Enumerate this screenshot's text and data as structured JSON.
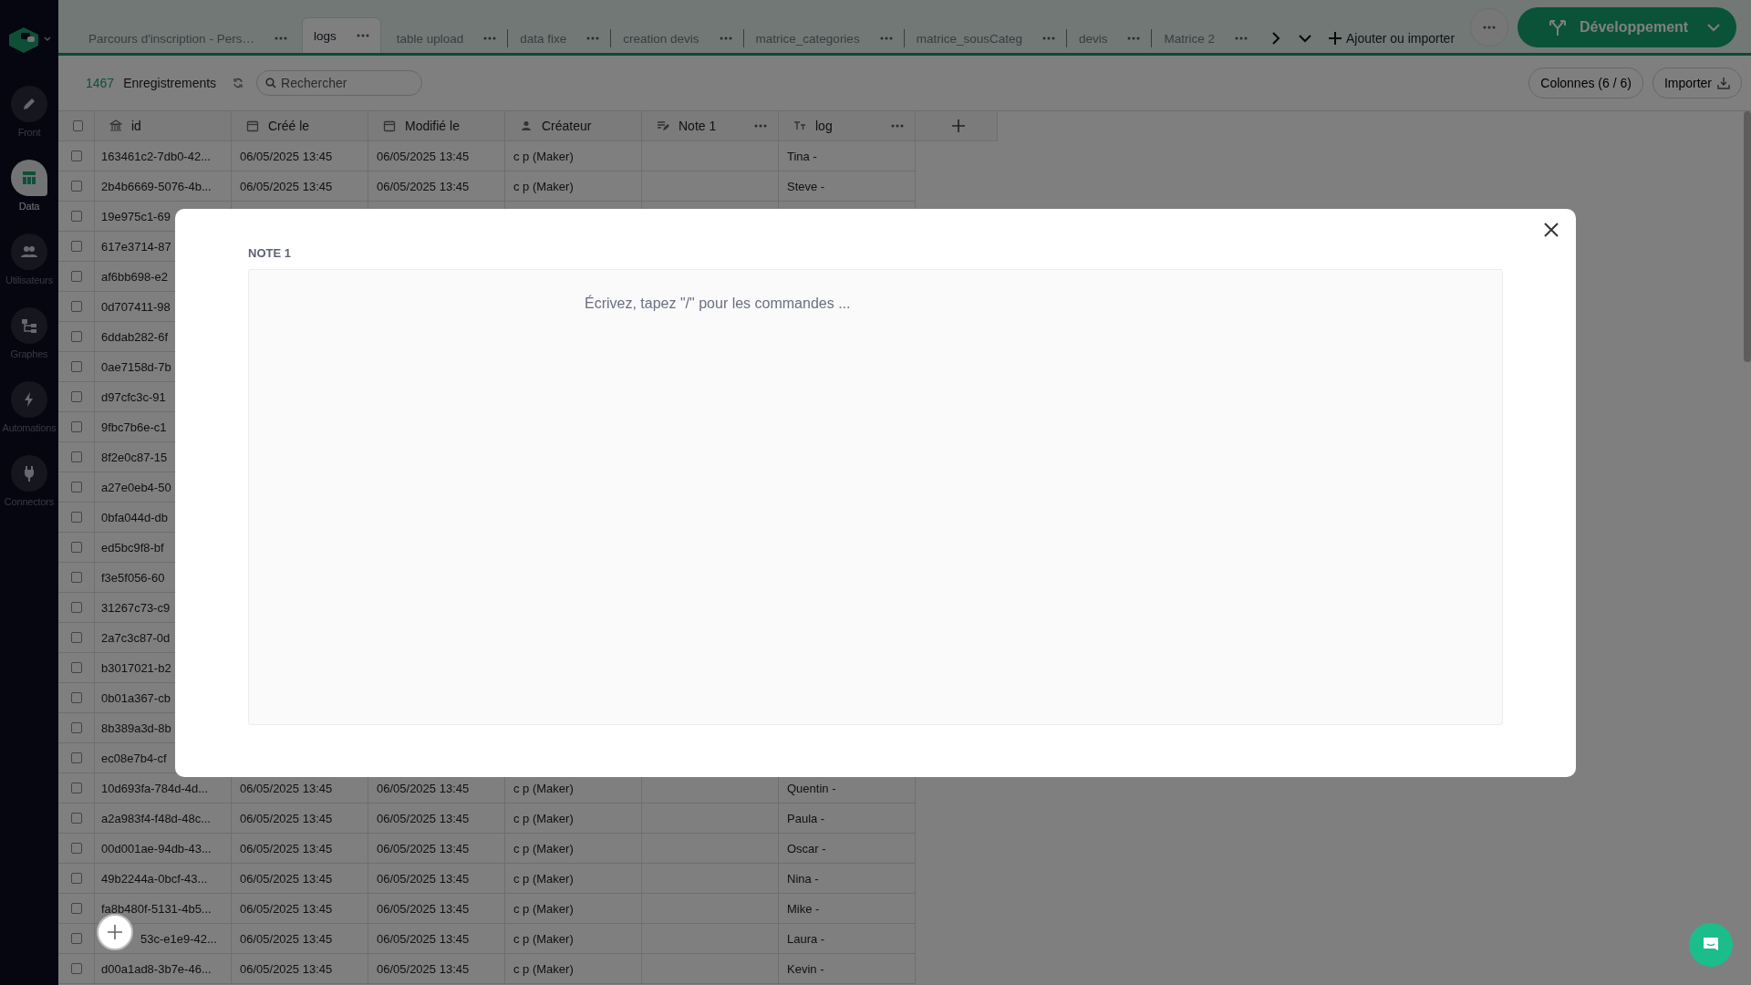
{
  "sidebar": {
    "items": [
      {
        "label": "Front",
        "kind": "pencil",
        "selected": false
      },
      {
        "label": "Data",
        "kind": "table",
        "selected": true
      },
      {
        "label": "Utilisateurs",
        "kind": "users",
        "selected": false
      },
      {
        "label": "Graphes",
        "kind": "graph",
        "selected": false
      },
      {
        "label": "Automations",
        "kind": "bolt",
        "selected": false
      },
      {
        "label": "Connectors",
        "kind": "plug",
        "selected": false
      }
    ]
  },
  "tabs": [
    {
      "label": "Parcours d'inscription - Pers…",
      "selected": false
    },
    {
      "label": "logs",
      "selected": true
    },
    {
      "label": "table upload",
      "selected": false
    },
    {
      "label": "data fixe",
      "selected": false
    },
    {
      "label": "creation devis",
      "selected": false
    },
    {
      "label": "matrice_categories",
      "selected": false
    },
    {
      "label": "matrice_sousCateg",
      "selected": false
    },
    {
      "label": "devis",
      "selected": false
    },
    {
      "label": "Matrice 2",
      "selected": false
    }
  ],
  "add_tab": {
    "label": "Ajouter ou importer"
  },
  "environment_button": {
    "label": "Développement"
  },
  "toolbar": {
    "count": "1467",
    "count_label": "Enregistrements",
    "search": {
      "placeholder": "Rechercher"
    },
    "columns_button": "Colonnes (6 / 6)",
    "import_button": "Importer"
  },
  "table": {
    "all_selected": false,
    "columns": [
      {
        "label": "id",
        "kind": "id",
        "menu": false
      },
      {
        "label": "Créé le",
        "kind": "date",
        "menu": false
      },
      {
        "label": "Modifié le",
        "kind": "date",
        "menu": false
      },
      {
        "label": "Créateur",
        "kind": "user",
        "menu": false
      },
      {
        "label": "Note 1",
        "kind": "richtext",
        "menu": true
      },
      {
        "label": "log",
        "kind": "text",
        "menu": true
      }
    ],
    "rows": [
      {
        "selected": false,
        "id": "163461c2-7db0-42...",
        "created": "06/05/2025 13:45",
        "modified": "06/05/2025 13:45",
        "creator": "c p (Maker)",
        "log": "Tina -"
      },
      {
        "selected": false,
        "id": "2b4b6669-5076-4b...",
        "created": "06/05/2025 13:45",
        "modified": "06/05/2025 13:45",
        "creator": "c p (Maker)",
        "log": "Steve -"
      },
      {
        "selected": false,
        "id": "19e975c1-69"
      },
      {
        "selected": false,
        "id": "617e3714-87"
      },
      {
        "selected": false,
        "id": "af6bb698-e2"
      },
      {
        "selected": false,
        "id": "0d707411-98"
      },
      {
        "selected": false,
        "id": "6ddab282-6f"
      },
      {
        "selected": false,
        "id": "0ae7158d-7b"
      },
      {
        "selected": false,
        "id": "d97cfc3c-91"
      },
      {
        "selected": false,
        "id": "9fbc7b6e-c1"
      },
      {
        "selected": false,
        "id": "8f2e0c87-15"
      },
      {
        "selected": false,
        "id": "a27e0eb4-50"
      },
      {
        "selected": false,
        "id": "0bfa044d-db"
      },
      {
        "selected": false,
        "id": "ed5bc9f8-bf"
      },
      {
        "selected": false,
        "id": "f3e5f056-60"
      },
      {
        "selected": false,
        "id": "31267c73-c9"
      },
      {
        "selected": false,
        "id": "2a7c3c87-0d"
      },
      {
        "selected": false,
        "id": "b3017021-b2"
      },
      {
        "selected": false,
        "id": "0b01a367-cb"
      },
      {
        "selected": false,
        "id": "8b389a3d-8b"
      },
      {
        "selected": false,
        "id": "ec08e7b4-cf"
      },
      {
        "selected": false,
        "id": "10d693fa-784d-4d...",
        "created": "06/05/2025 13:45",
        "modified": "06/05/2025 13:45",
        "creator": "c p (Maker)",
        "log": "Quentin -"
      },
      {
        "selected": false,
        "id": "a2a983f4-f48d-48c...",
        "created": "06/05/2025 13:45",
        "modified": "06/05/2025 13:45",
        "creator": "c p (Maker)",
        "log": "Paula -"
      },
      {
        "selected": false,
        "id": "00d001ae-94db-43...",
        "created": "06/05/2025 13:45",
        "modified": "06/05/2025 13:45",
        "creator": "c p (Maker)",
        "log": "Oscar -"
      },
      {
        "selected": false,
        "id": "49b2244a-0bcf-43...",
        "created": "06/05/2025 13:45",
        "modified": "06/05/2025 13:45",
        "creator": "c p (Maker)",
        "log": "Nina -"
      },
      {
        "selected": false,
        "id": "fa8b480f-5131-4b5...",
        "created": "06/05/2025 13:45",
        "modified": "06/05/2025 13:45",
        "creator": "c p (Maker)",
        "log": "Mike -"
      },
      {
        "selected": false,
        "id": "53c-e1e9-42...",
        "created": "06/05/2025 13:45",
        "modified": "06/05/2025 13:45",
        "creator": "c p (Maker)",
        "log": "Laura -"
      },
      {
        "selected": false,
        "id": "d00a1ad8-3b7e-46...",
        "created": "06/05/2025 13:45",
        "modified": "06/05/2025 13:45",
        "creator": "c p (Maker)",
        "log": "Kevin -"
      }
    ]
  },
  "modal": {
    "label": "NOTE 1",
    "editor": {
      "placeholder": "Écrivez, tapez \"/\" pour les commandes ..."
    }
  }
}
